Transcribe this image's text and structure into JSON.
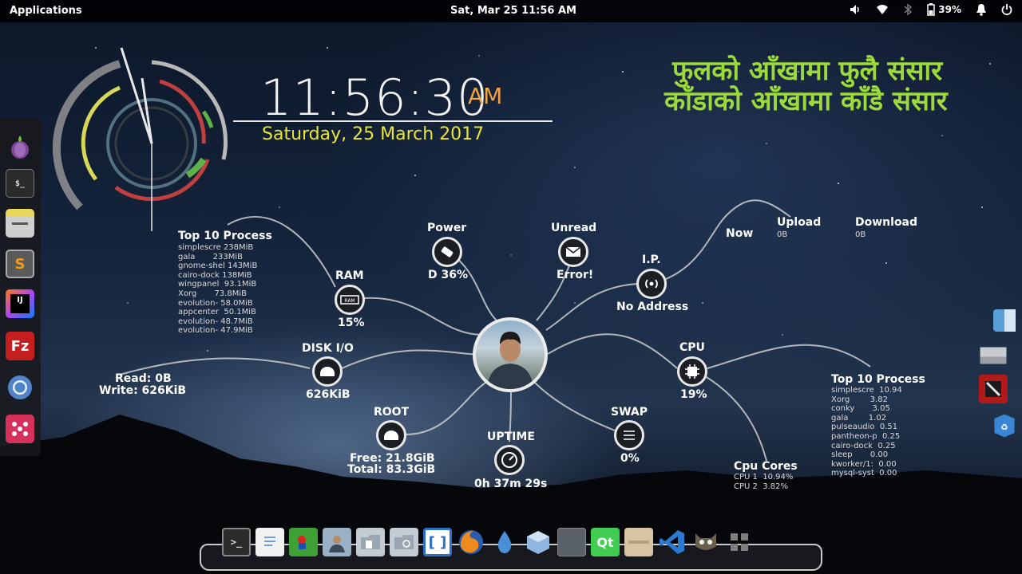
{
  "topbar": {
    "applications_label": "Applications",
    "datetime": "Sat, Mar 25   11:56 AM",
    "battery_percent": "39%",
    "icons": [
      "volume-icon",
      "wifi-icon",
      "bluetooth-icon",
      "battery-icon",
      "notifications-icon",
      "power-icon"
    ]
  },
  "clock": {
    "time": "11:56:30",
    "ampm": "AM",
    "date": "Saturday, 25 March 2017"
  },
  "quote": {
    "line1": "फुलको आँखामा फुलै संसार",
    "line2": "काँडाको आँखामा काँडै संसार"
  },
  "nodes": {
    "ram": {
      "label": "RAM",
      "value": "15%"
    },
    "power": {
      "label": "Power",
      "value": "D 36%"
    },
    "unread": {
      "label": "Unread",
      "value": "Error!"
    },
    "ip": {
      "label": "I.P.",
      "value": "No Address"
    },
    "now": {
      "label": "Now"
    },
    "upload": {
      "label": "Upload",
      "value": "0B"
    },
    "download": {
      "label": "Download",
      "value": "0B"
    },
    "disk_io": {
      "label": "DISK I/O",
      "value": "626KiB"
    },
    "disk_rw": {
      "read": "Read: 0B",
      "write": "Write: 626KiB"
    },
    "cpu": {
      "label": "CPU",
      "value": "19%"
    },
    "root": {
      "label": "ROOT",
      "free": "Free: 21.8GiB",
      "total": "Total: 83.3GiB"
    },
    "uptime": {
      "label": "UPTIME",
      "value": "0h 37m 29s"
    },
    "swap": {
      "label": "SWAP",
      "value": "0%"
    }
  },
  "top_mem": {
    "title": "Top 10 Process",
    "rows": "simplescre 238MiB\ngala       233MiB\ngnome-shel 143MiB\ncairo-dock 138MiB\nwingpanel  93.1MiB\nXorg       73.8MiB\nevolution- 58.0MiB\nappcenter  50.1MiB\nevolution- 48.7MiB\nevolution- 47.9MiB"
  },
  "top_cpu": {
    "title": "Top 10 Process",
    "rows": "simplescre  10.94\nXorg        3.82\nconky       3.05\ngala        1.02\npulseaudio  0.51\npantheon-p  0.25\ncairo-dock  0.25\nsleep       0.00\nkworker/1:  0.00\nmysql-syst  0.00"
  },
  "cpu_cores": {
    "title": "Cpu Cores",
    "rows": "CPU 1  10.94%\nCPU 2  3.82%"
  },
  "dock_left": [
    "tor-browser-icon",
    "terminal-icon",
    "files-icon",
    "sublime-text-icon",
    "intellij-icon",
    "filezilla-icon",
    "chromium-icon",
    "app-grid-icon"
  ],
  "dock_bottom": [
    "terminal-icon",
    "text-editor-icon",
    "game-icon",
    "photo-icon",
    "folder-icon",
    "folder-backup-icon",
    "brackets-icon",
    "firefox-icon",
    "drop-icon",
    "box-icon",
    "screen-icon",
    "qt-icon",
    "archive-icon",
    "vscode-icon",
    "gimp-icon",
    "app-grid-icon"
  ],
  "dock_right": [
    "finder-icon",
    "disk-icon",
    "dota-icon",
    "recycle-icon"
  ],
  "colors": {
    "accent_time": "#f0a340",
    "date": "#e8e635",
    "quote": "#9cd93a"
  }
}
